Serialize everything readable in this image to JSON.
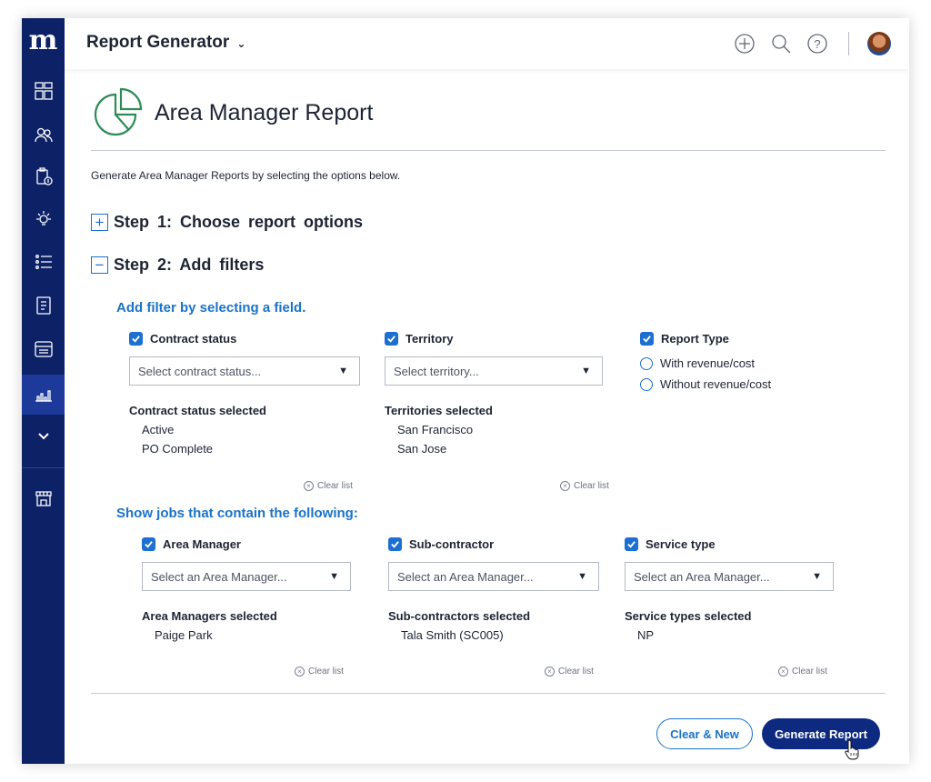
{
  "sidebar": {
    "logo": "m",
    "icons": [
      "dashboard-icon",
      "people-icon",
      "billing-icon",
      "ideas-icon",
      "list-icon",
      "document-icon",
      "table-icon",
      "reports-icon",
      "chevron-down-icon",
      "store-icon"
    ]
  },
  "header": {
    "app_title": "Report Generator",
    "icons": [
      "add-icon",
      "search-icon",
      "help-icon"
    ]
  },
  "page": {
    "title": "Area Manager Report",
    "intro": "Generate Area Manager Reports by selecting the options below.",
    "step1": "Step 1: Choose report options",
    "step2": "Step 2: Add filters",
    "step1_toggle": "+",
    "step2_toggle": "−"
  },
  "filters": {
    "section_label": "Add filter by selecting a field.",
    "contract_status": {
      "label": "Contract status",
      "placeholder": "Select contract status...",
      "selected_label": "Contract status selected",
      "selected": [
        "Active",
        "PO Complete"
      ],
      "clear": "Clear list"
    },
    "territory": {
      "label": "Territory",
      "placeholder": "Select territory...",
      "selected_label": "Territories selected",
      "selected": [
        "San Francisco",
        "San Jose"
      ],
      "clear": "Clear list"
    },
    "report_type": {
      "label": "Report Type",
      "options": [
        "With revenue/cost",
        "Without revenue/cost"
      ]
    }
  },
  "jobs": {
    "section_label": "Show jobs that contain the following:",
    "area_manager": {
      "label": "Area Manager",
      "placeholder": "Select an Area Manager...",
      "selected_label": "Area Managers selected",
      "selected": [
        "Paige Park"
      ],
      "clear": "Clear list"
    },
    "sub_contractor": {
      "label": "Sub-contractor",
      "placeholder": "Select an Area Manager...",
      "selected_label": "Sub-contractors selected",
      "selected": [
        "Tala Smith (SC005)"
      ],
      "clear": "Clear list"
    },
    "service_type": {
      "label": "Service type",
      "placeholder": "Select an Area Manager...",
      "selected_label": "Service types selected",
      "selected": [
        "NP"
      ],
      "clear": "Clear list"
    }
  },
  "actions": {
    "clear_new": "Clear & New",
    "generate": "Generate Report"
  },
  "colors": {
    "sidebar": "#0d2167",
    "accent": "#1d6fd1",
    "section_heading": "#1a73c9",
    "primary_button": "#0d2a80",
    "report_icon": "#2e8b57"
  }
}
